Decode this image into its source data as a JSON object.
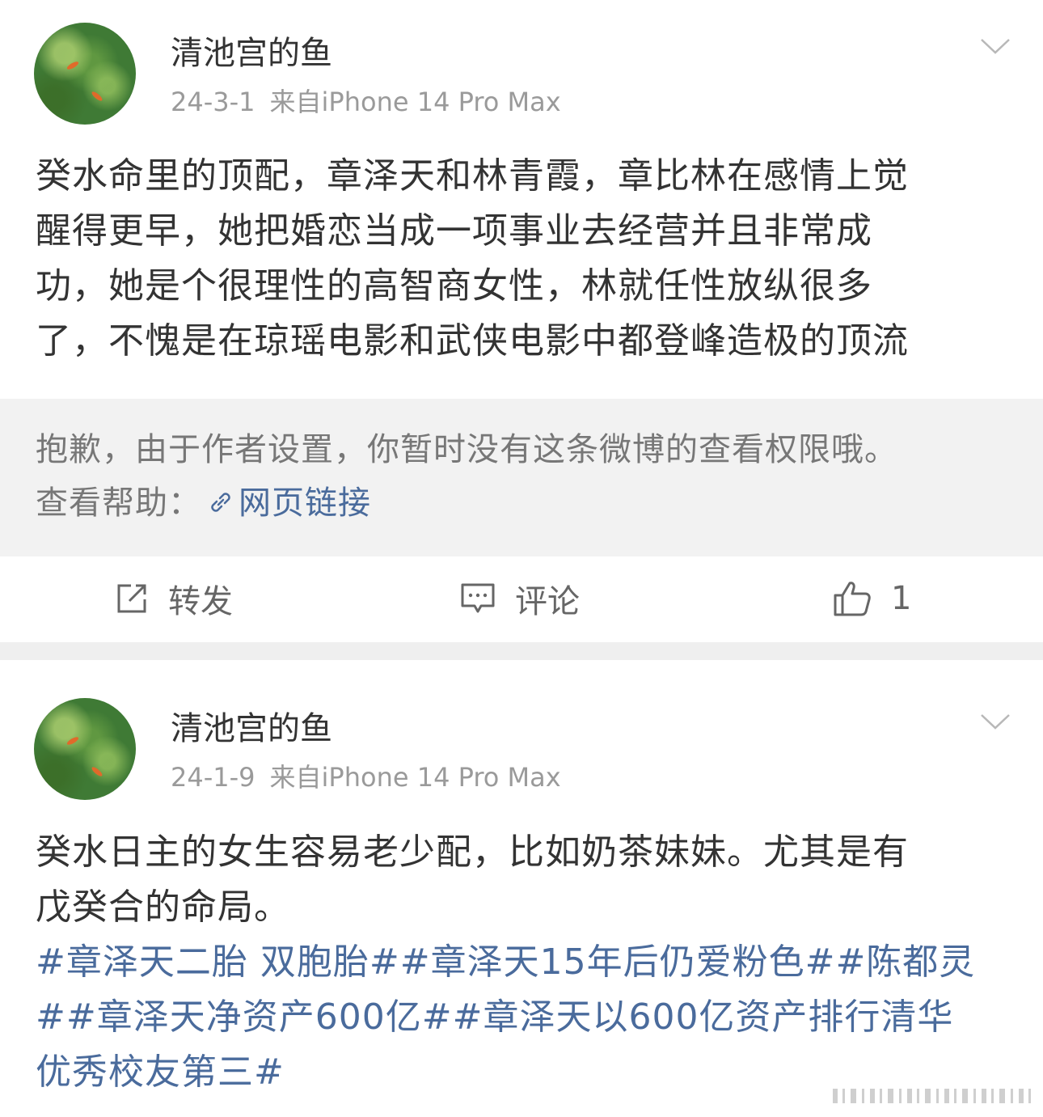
{
  "posts": [
    {
      "author": "清池宫的鱼",
      "date": "24-3-1",
      "source": "来自iPhone 14 Pro Max",
      "content_lines": [
        "癸水命里的顶配，章泽天和林青霞，章比林在感情上觉",
        "醒得更早，她把婚恋当成一项事业去经营并且非常成",
        "功，她是个很理性的高智商女性，林就任性放纵很多",
        "了，不愧是在琼瑶电影和武侠电影中都登峰造极的顶流"
      ],
      "notice": {
        "message": "抱歉，由于作者设置，你暂时没有这条微博的查看权限哦。",
        "help_label": "查看帮助：",
        "link_text": "网页链接"
      },
      "actions": {
        "repost_label": "转发",
        "comment_label": "评论",
        "like_count": "1"
      }
    },
    {
      "author": "清池宫的鱼",
      "date": "24-1-9",
      "source": "来自iPhone 14 Pro Max",
      "content_lines": [
        "癸水日主的女生容易老少配，比如奶茶妹妹。尤其是有",
        "戊癸合的命局。"
      ],
      "topic_lines": [
        "#章泽天二胎 双胞胎##章泽天15年后仍爱粉色##陈都灵",
        "##章泽天净资产600亿##章泽天以600亿资产排行清华",
        "优秀校友第三#"
      ]
    }
  ],
  "colors": {
    "topic_link": "#4a6b9c",
    "meta_gray": "#9a9a9a",
    "notice_bg": "#f2f2f2"
  },
  "icons": {
    "menu": "chevron-down-icon",
    "repost": "repost-icon",
    "comment": "comment-icon",
    "like": "thumbs-up-icon",
    "link": "link-icon"
  }
}
